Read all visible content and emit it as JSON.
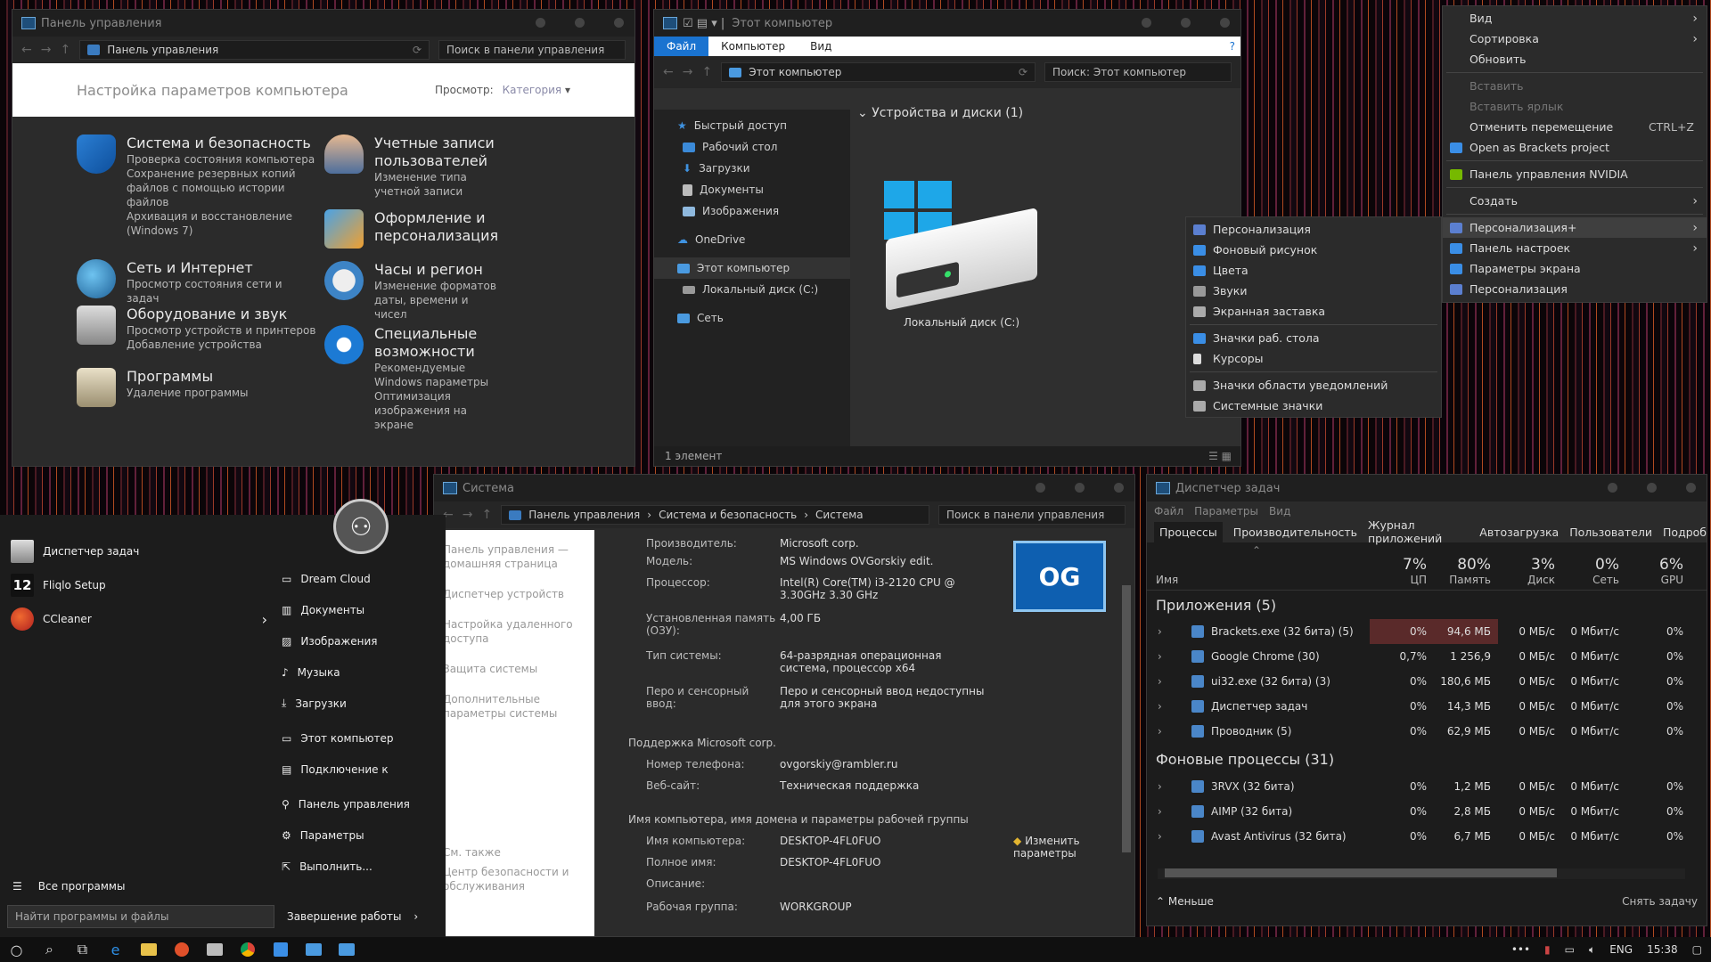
{
  "control_panel": {
    "title": "Панель управления",
    "address": "Панель управления",
    "search_placeholder": "Поиск в панели управления",
    "heading": "Настройка параметров компьютера",
    "view_label": "Просмотр:",
    "view_value": "Категория",
    "categories": [
      {
        "title": "Система и безопасность",
        "links": [
          "Проверка состояния компьютера",
          "Сохранение резервных копий файлов с помощью истории файлов",
          "Архивация и восстановление (Windows 7)"
        ]
      },
      {
        "title": "Сеть и Интернет",
        "links": [
          "Просмотр состояния сети и задач"
        ]
      },
      {
        "title": "Оборудование и звук",
        "links": [
          "Просмотр устройств и принтеров",
          "Добавление устройства"
        ]
      },
      {
        "title": "Программы",
        "links": [
          "Удаление программы"
        ]
      },
      {
        "title": "Учетные записи пользователей",
        "links": [
          "Изменение типа учетной записи"
        ]
      },
      {
        "title": "Оформление и персонализация",
        "links": []
      },
      {
        "title": "Часы и регион",
        "links": [
          "Изменение форматов даты, времени и чисел"
        ]
      },
      {
        "title": "Специальные возможности",
        "links": [
          "Рекомендуемые Windows параметры",
          "Оптимизация изображения на экране"
        ]
      }
    ]
  },
  "explorer": {
    "title": "Этот компьютер",
    "ribbon": [
      "Файл",
      "Компьютер",
      "Вид"
    ],
    "address": "Этот компьютер",
    "search_placeholder": "Поиск: Этот компьютер",
    "nav": [
      "Быстрый доступ",
      "Рабочий стол",
      "Загрузки",
      "Документы",
      "Изображения",
      "OneDrive",
      "Этот компьютер",
      "Локальный диск (C:)",
      "Сеть"
    ],
    "group_header": "Устройства и диски (1)",
    "drive_label": "Локальный диск (C:)",
    "status": "1 элемент"
  },
  "context_menu": {
    "items": [
      "Вид",
      "Сортировка",
      "Обновить",
      "Вставить",
      "Вставить ярлык",
      "Отменить перемещение",
      "Open as Brackets project",
      "Панель управления NVIDIA",
      "Создать",
      "Персонализация+",
      "Панель настроек",
      "Параметры экрана",
      "Персонализация"
    ],
    "shortcut_undo": "CTRL+Z"
  },
  "submenu": {
    "items": [
      "Персонализация",
      "Фоновый рисунок",
      "Цвета",
      "Звуки",
      "Экранная заставка",
      "Значки раб. стола",
      "Курсоры",
      "Значки области уведомлений",
      "Системные значки"
    ]
  },
  "start_menu": {
    "apps": [
      "Диспетчер задач",
      "Fliqlo Setup",
      "CCleaner"
    ],
    "app_badge": "12",
    "places": [
      "Dream Cloud",
      "Документы",
      "Изображения",
      "Музыка",
      "Загрузки",
      "Этот компьютер",
      "Подключение к",
      "Панель управления",
      "Параметры",
      "Выполнить..."
    ],
    "all_programs": "Все программы",
    "search_placeholder": "Найти программы и файлы",
    "shutdown": "Завершение работы"
  },
  "system": {
    "title": "Система",
    "breadcrumb": [
      "Панель управления",
      "Система и безопасность",
      "Система"
    ],
    "search_placeholder": "Поиск в панели управления",
    "left_links": [
      "Панель управления — домашняя страница",
      "Диспетчер устройств",
      "Настройка удаленного доступа",
      "Защита системы",
      "Дополнительные параметры системы"
    ],
    "see_also": "См. также",
    "see_also_link": "Центр безопасности и обслуживания",
    "rows": [
      {
        "k": "Производитель:",
        "v": "Microsoft corp."
      },
      {
        "k": "Модель:",
        "v": "MS Windows OVGorskiy edit."
      },
      {
        "k": "Процессор:",
        "v": "Intel(R) Core(TM) i3-2120 CPU @ 3.30GHz 3.30 GHz"
      },
      {
        "k": "Установленная память (ОЗУ):",
        "v": "4,00 ГБ"
      },
      {
        "k": "Тип системы:",
        "v": "64-разрядная операционная система, процессор x64"
      },
      {
        "k": "Перо и сенсорный ввод:",
        "v": "Перо и сенсорный ввод недоступны для этого экрана"
      }
    ],
    "support_header": "Поддержка Microsoft corp.",
    "support_rows": [
      {
        "k": "Номер телефона:",
        "v": "ovgorskiy@rambler.ru"
      },
      {
        "k": "Веб-сайт:",
        "v": "Техническая поддержка"
      }
    ],
    "name_header": "Имя компьютера, имя домена и параметры рабочей группы",
    "name_rows": [
      {
        "k": "Имя компьютера:",
        "v": "DESKTOP-4FL0FUO"
      },
      {
        "k": "Полное имя:",
        "v": "DESKTOP-4FL0FUO"
      },
      {
        "k": "Описание:",
        "v": ""
      },
      {
        "k": "Рабочая группа:",
        "v": "WORKGROUP"
      }
    ],
    "change_link": "Изменить параметры",
    "logo_text": "OG"
  },
  "taskmgr": {
    "title": "Диспетчер задач",
    "menu": [
      "Файл",
      "Параметры",
      "Вид"
    ],
    "tabs": [
      "Процессы",
      "Производительность",
      "Журнал приложений",
      "Автозагрузка",
      "Пользователи",
      "Подроб"
    ],
    "col_name": "Имя",
    "columns": [
      {
        "pct": "7%",
        "label": "ЦП"
      },
      {
        "pct": "80%",
        "label": "Память"
      },
      {
        "pct": "3%",
        "label": "Диск"
      },
      {
        "pct": "0%",
        "label": "Сеть"
      },
      {
        "pct": "6%",
        "label": "GPU"
      }
    ],
    "apps_header": "Приложения (5)",
    "apps": [
      {
        "name": "Brackets.exe (32 бита) (5)",
        "cpu": "0%",
        "mem": "94,6 МБ",
        "disk": "0 МБ/с",
        "net": "0 Мбит/с",
        "gpu": "0%"
      },
      {
        "name": "Google Chrome (30)",
        "cpu": "0,7%",
        "mem": "1 256,9",
        "disk": "0 МБ/с",
        "net": "0 Мбит/с",
        "gpu": "0%"
      },
      {
        "name": "ui32.exe (32 бита) (3)",
        "cpu": "0%",
        "mem": "180,6 МБ",
        "disk": "0 МБ/с",
        "net": "0 Мбит/с",
        "gpu": "0%"
      },
      {
        "name": "Диспетчер задач",
        "cpu": "0%",
        "mem": "14,3 МБ",
        "disk": "0 МБ/с",
        "net": "0 Мбит/с",
        "gpu": "0%"
      },
      {
        "name": "Проводник (5)",
        "cpu": "0%",
        "mem": "62,9 МБ",
        "disk": "0 МБ/с",
        "net": "0 Мбит/с",
        "gpu": "0%"
      }
    ],
    "bg_header": "Фоновые процессы (31)",
    "bg": [
      {
        "name": "3RVX (32 бита)",
        "cpu": "0%",
        "mem": "1,2 МБ",
        "disk": "0 МБ/с",
        "net": "0 Мбит/с",
        "gpu": "0%"
      },
      {
        "name": "AIMP (32 бита)",
        "cpu": "0%",
        "mem": "2,8 МБ",
        "disk": "0 МБ/с",
        "net": "0 Мбит/с",
        "gpu": "0%"
      },
      {
        "name": "Avast Antivirus (32 бита)",
        "cpu": "0%",
        "mem": "6,7 МБ",
        "disk": "0 МБ/с",
        "net": "0 Мбит/с",
        "gpu": "0%"
      }
    ],
    "less": "Меньше",
    "end_task": "Снять задачу"
  },
  "taskbar": {
    "lang": "ENG",
    "time": "15:38"
  }
}
